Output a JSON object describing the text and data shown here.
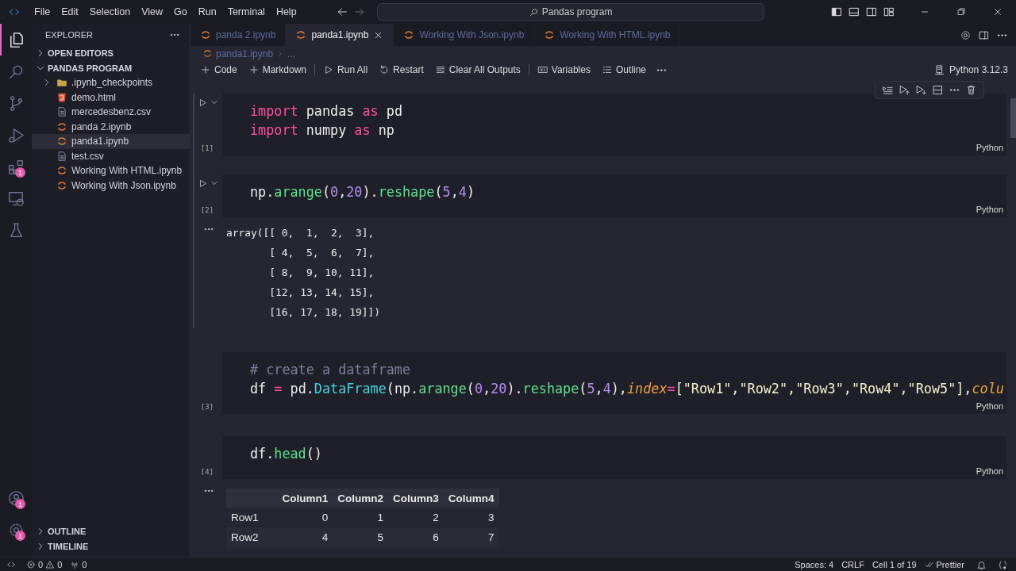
{
  "title_bar": {
    "menu": [
      "File",
      "Edit",
      "Selection",
      "View",
      "Go",
      "Run",
      "Terminal",
      "Help"
    ],
    "search": "Pandas program"
  },
  "activity_bar": {
    "items": [
      {
        "kind": "explorer",
        "selected": true
      },
      {
        "kind": "search",
        "selected": false
      },
      {
        "kind": "source_control",
        "selected": false
      },
      {
        "kind": "run_debug",
        "selected": false
      },
      {
        "kind": "extensions",
        "selected": false,
        "badge": "1"
      },
      {
        "kind": "remote",
        "selected": false
      },
      {
        "kind": "testing",
        "selected": false
      }
    ],
    "bottom": [
      {
        "kind": "account",
        "badge": "1"
      },
      {
        "kind": "settings",
        "badge": "1"
      }
    ]
  },
  "sidebar": {
    "title": "EXPLORER",
    "sections": [
      {
        "label": "OPEN EDITORS",
        "expanded": false
      },
      {
        "label": "PANDAS PROGRAM",
        "expanded": true,
        "items": [
          {
            "label": ".ipynb_checkpoints",
            "kind": "folder",
            "selected": false
          },
          {
            "label": "demo.html",
            "kind": "html",
            "selected": false
          },
          {
            "label": "mercedesbenz.csv",
            "kind": "text",
            "selected": false
          },
          {
            "label": "panda 2.ipynb",
            "kind": "notebook",
            "selected": false
          },
          {
            "label": "panda1.ipynb",
            "kind": "notebook",
            "selected": true
          },
          {
            "label": "test.csv",
            "kind": "text",
            "selected": false
          },
          {
            "label": "Working With HTML.ipynb",
            "kind": "notebook",
            "selected": false
          },
          {
            "label": "Working With Json.ipynb",
            "kind": "notebook",
            "selected": false
          }
        ]
      }
    ],
    "bottom_sections": [
      {
        "label": "OUTLINE",
        "expanded": false
      },
      {
        "label": "TIMELINE",
        "expanded": false
      }
    ]
  },
  "tabs": [
    {
      "label": "panda 2.ipynb",
      "selected": false
    },
    {
      "label": "panda1.ipynb",
      "selected": true
    },
    {
      "label": "Working With Json.ipynb",
      "selected": false
    },
    {
      "label": "Working With HTML.ipynb",
      "selected": false
    }
  ],
  "breadcrumb": [
    "panda1.ipynb",
    "..."
  ],
  "toolbar": {
    "items": [
      {
        "kind": "add",
        "label": "Code"
      },
      {
        "kind": "add",
        "label": "Markdown"
      },
      {
        "kind": "run_all",
        "label": "Run All"
      },
      {
        "kind": "restart",
        "label": "Restart"
      },
      {
        "kind": "clear",
        "label": "Clear All Outputs"
      },
      {
        "kind": "variables",
        "label": "Variables"
      },
      {
        "kind": "outline",
        "label": "Outline"
      }
    ],
    "kernel": "Python 3.12.3"
  },
  "cells": [
    {
      "execution_count": "[1]",
      "language": "Python",
      "selected": true,
      "run_button": true,
      "cell_toolbar": true,
      "lines": [
        [
          {
            "t": "import",
            "kind": "keyword"
          },
          {
            "t": " pandas ",
            "kind": "name"
          },
          {
            "t": "as",
            "kind": "keyword"
          },
          {
            "t": " pd",
            "kind": "name"
          }
        ],
        [
          {
            "t": "import",
            "kind": "keyword"
          },
          {
            "t": " numpy ",
            "kind": "name"
          },
          {
            "t": "as",
            "kind": "keyword"
          },
          {
            "t": " np",
            "kind": "name"
          }
        ]
      ]
    },
    {
      "execution_count": "[2]",
      "language": "Python",
      "selected": true,
      "run_button": true,
      "cell_toolbar": false,
      "lines": [
        [
          {
            "t": "np.",
            "kind": "name"
          },
          {
            "t": "arange",
            "kind": "function"
          },
          {
            "t": "(",
            "kind": "name"
          },
          {
            "t": "0",
            "kind": "number"
          },
          {
            "t": ",",
            "kind": "name"
          },
          {
            "t": "20",
            "kind": "number"
          },
          {
            "t": ").",
            "kind": "name"
          },
          {
            "t": "reshape",
            "kind": "function"
          },
          {
            "t": "(",
            "kind": "name"
          },
          {
            "t": "5",
            "kind": "number"
          },
          {
            "t": ",",
            "kind": "name"
          },
          {
            "t": "4",
            "kind": "number"
          },
          {
            "t": ")",
            "kind": "name"
          }
        ]
      ],
      "output": {
        "kind": "text",
        "lines": [
          "array([[ 0,  1,  2,  3],",
          "       [ 4,  5,  6,  7],",
          "       [ 8,  9, 10, 11],",
          "       [12, 13, 14, 15],",
          "       [16, 17, 18, 19]])"
        ]
      }
    },
    {
      "execution_count": "[3]",
      "language": "Python",
      "selected": false,
      "run_button": false,
      "cell_toolbar": false,
      "lines": [
        [
          {
            "t": "# create a dataframe",
            "kind": "comment"
          }
        ],
        [
          {
            "t": "df ",
            "kind": "name"
          },
          {
            "t": "=",
            "kind": "operator"
          },
          {
            "t": " pd.",
            "kind": "name"
          },
          {
            "t": "DataFrame",
            "kind": "class"
          },
          {
            "t": "(np.",
            "kind": "name"
          },
          {
            "t": "arange",
            "kind": "function"
          },
          {
            "t": "(",
            "kind": "name"
          },
          {
            "t": "0",
            "kind": "number"
          },
          {
            "t": ",",
            "kind": "name"
          },
          {
            "t": "20",
            "kind": "number"
          },
          {
            "t": ").",
            "kind": "name"
          },
          {
            "t": "reshape",
            "kind": "function"
          },
          {
            "t": "(",
            "kind": "name"
          },
          {
            "t": "5",
            "kind": "number"
          },
          {
            "t": ",",
            "kind": "name"
          },
          {
            "t": "4",
            "kind": "number"
          },
          {
            "t": "),",
            "kind": "name"
          },
          {
            "t": "index",
            "kind": "parameter"
          },
          {
            "t": "=",
            "kind": "operator"
          },
          {
            "t": "[\"Row1\",\"Row2\",\"Row3\",\"Row4\",\"Row5\"],",
            "kind": "string"
          },
          {
            "t": "colu",
            "kind": "parameter"
          }
        ]
      ]
    },
    {
      "execution_count": "[4]",
      "language": "Python",
      "selected": false,
      "run_button": false,
      "cell_toolbar": false,
      "lines": [
        [
          {
            "t": "df.",
            "kind": "name"
          },
          {
            "t": "head",
            "kind": "function"
          },
          {
            "t": "()",
            "kind": "name"
          }
        ]
      ],
      "output": {
        "kind": "table",
        "columns": [
          "Column1",
          "Column2",
          "Column3",
          "Column4"
        ],
        "rows": [
          {
            "index": "Row1",
            "cells": [
              "0",
              "1",
              "2",
              "3"
            ]
          },
          {
            "index": "Row2",
            "cells": [
              "4",
              "5",
              "6",
              "7"
            ]
          }
        ]
      }
    }
  ],
  "status_bar": {
    "errors": "0",
    "warnings": "0",
    "ports": "0",
    "right": [
      "Spaces: 4",
      "CRLF",
      "Cell 1 of 19"
    ],
    "formatter": "Prettier"
  }
}
